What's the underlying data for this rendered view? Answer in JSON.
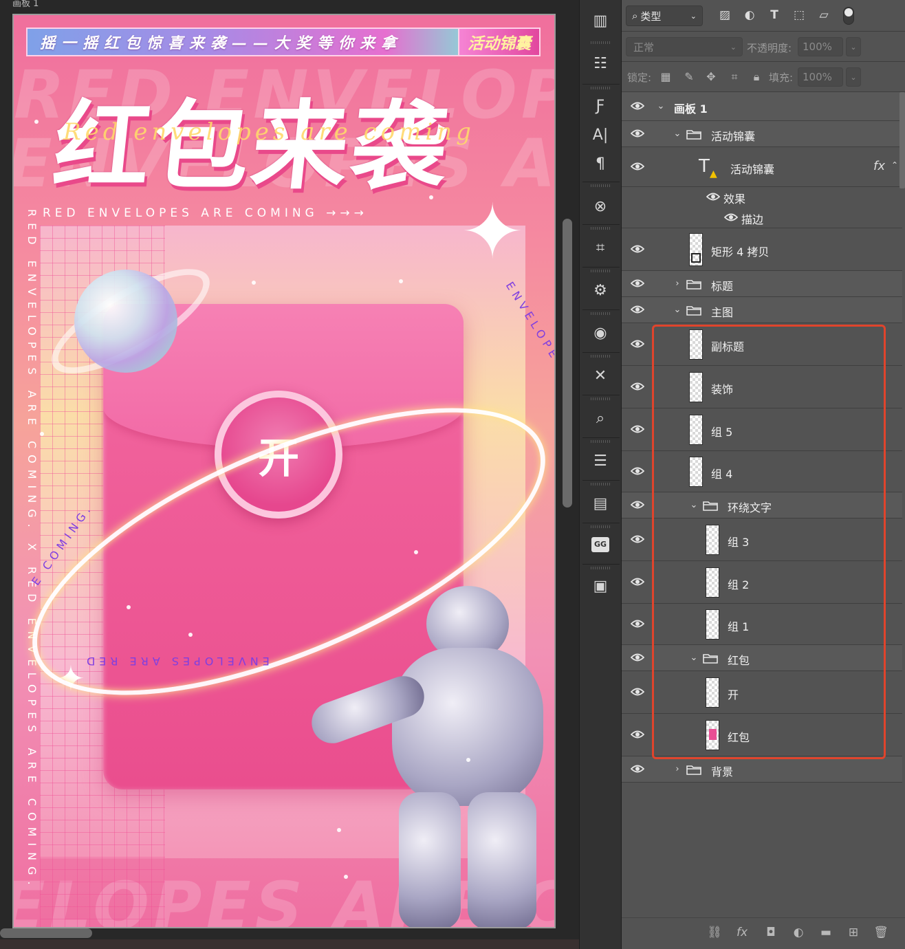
{
  "canvas": {
    "artboard_label": "画板 1",
    "banner_text": "摇一摇红包惊喜来袭——大奖等你来拿",
    "banner_tag": "活动锦囊",
    "main_title": "红包来袭",
    "script_title": "Red envelopes are coming",
    "subtitle": "RED ENVELOPES ARE COMING →→→",
    "vertical_text": "RED ENVELOPES ARE COMING. X RED ENVELOPES ARE COMING.",
    "bg_words": [
      "RED ENVELOPES",
      "ENVELOPES ARE",
      "ELOPES ARE C"
    ],
    "open_label": "开",
    "ring_text_1": "ENVELOPES ARE COMING. X RED",
    "ring_text_2": "ENVELOPES ARE RED",
    "ring_text_3": "E COMING."
  },
  "toolbar": {
    "tools": [
      "history-brush-icon",
      "adjustments-icon",
      "glyphs-icon",
      "character-icon",
      "paragraph-icon",
      "3d-icon",
      "crop-icon",
      "plugins-icon",
      "comps-icon",
      "layer-comps-icon",
      "magnify-icon",
      "libraries-icon",
      "actions-icon",
      "gg-icon",
      "book-icon"
    ],
    "gg_label": "GG"
  },
  "layers_panel": {
    "filter_label": "类型",
    "blend_mode": "正常",
    "opacity_label": "不透明度:",
    "opacity_value": "100%",
    "lock_label": "锁定:",
    "fill_label": "填充:",
    "fill_value": "100%",
    "fx_label": "fx",
    "layers": [
      {
        "name": "画板 1"
      },
      {
        "name": "活动锦囊"
      },
      {
        "name": "活动锦囊"
      },
      {
        "name": "效果"
      },
      {
        "name": "描边"
      },
      {
        "name": "矩形 4 拷贝"
      },
      {
        "name": "标题"
      },
      {
        "name": "主图"
      },
      {
        "name": "副标题"
      },
      {
        "name": "装饰"
      },
      {
        "name": "组 5"
      },
      {
        "name": "组 4"
      },
      {
        "name": "环绕文字"
      },
      {
        "name": "组 3"
      },
      {
        "name": "组 2"
      },
      {
        "name": "组 1"
      },
      {
        "name": "红包"
      },
      {
        "name": "开"
      },
      {
        "name": "红包"
      },
      {
        "name": "背景"
      }
    ],
    "footer_icons": [
      "link-icon",
      "fx-icon",
      "mask-icon",
      "adjustment-icon",
      "group-folder-icon",
      "new-layer-icon",
      "delete-icon"
    ],
    "footer_fx": "fx"
  },
  "colors": {
    "accent_highlight": "#e0442c",
    "panel_bg": "#535353",
    "envelope_pink": "#ef5d98"
  }
}
